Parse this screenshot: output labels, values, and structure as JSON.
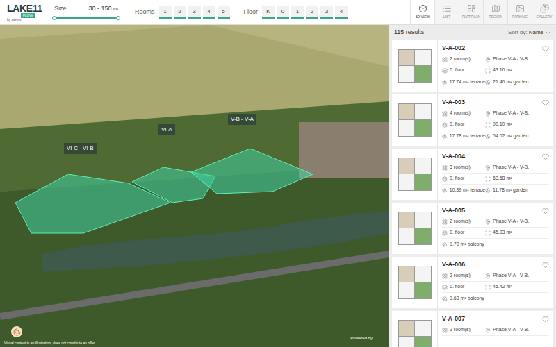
{
  "logo": {
    "name": "LAKE11",
    "badge": "FLOW",
    "by": "by atenor"
  },
  "filters": {
    "size": {
      "label": "Size",
      "value": "30 - 150",
      "unit": "m²",
      "level_start": 0,
      "level_end": 1
    },
    "rooms": {
      "label": "Rooms",
      "options": [
        {
          "label": "1",
          "selected": false
        },
        {
          "label": "2",
          "selected": false
        },
        {
          "label": "3",
          "selected": false
        },
        {
          "label": "4",
          "selected": false
        },
        {
          "label": "5",
          "selected": false
        }
      ]
    },
    "floor": {
      "label": "Floor",
      "options": [
        {
          "label": "K",
          "selected": false
        },
        {
          "label": "0",
          "selected": false
        },
        {
          "label": "1",
          "selected": false
        },
        {
          "label": "2",
          "selected": false
        },
        {
          "label": "3",
          "selected": false
        },
        {
          "label": "4",
          "selected": false
        }
      ]
    }
  },
  "views": [
    {
      "label": "3D VIEW",
      "selected": true
    },
    {
      "label": "LIST",
      "selected": false
    },
    {
      "label": "FLAT PLAN",
      "selected": false
    },
    {
      "label": "REGION",
      "selected": false
    },
    {
      "label": "PARKING",
      "selected": false
    },
    {
      "label": "GALLERY",
      "selected": false
    }
  ],
  "map": {
    "zones": [
      {
        "label": "VI-C - VI-B"
      },
      {
        "label": "VI-A"
      },
      {
        "label": "V-B - V-A"
      }
    ],
    "disclaimer": "Visual content is an illustration, does not constitute an offer.",
    "powered_by": "Powered by"
  },
  "results": {
    "count": "115 results",
    "sort_label": "Sort by:",
    "sort_value": "Name"
  },
  "flats": [
    {
      "code": "V-A-002",
      "rooms": "2 room(s)",
      "phase": "Phase V-A - V-B.",
      "floor": "0. floor",
      "area": "43.16 m²",
      "extras": [
        "17.74 m² terrace",
        "21.46 m² garden"
      ],
      "favorite": false
    },
    {
      "code": "V-A-003",
      "rooms": "4 room(s)",
      "phase": "Phase V-A - V-B.",
      "floor": "0. floor",
      "area": "90.10 m²",
      "extras": [
        "17.78 m² terrace",
        "54.62 m² garden"
      ],
      "favorite": false
    },
    {
      "code": "V-A-004",
      "rooms": "3 room(s)",
      "phase": "Phase V-A - V-B.",
      "floor": "0. floor",
      "area": "63.58 m²",
      "extras": [
        "10.39 m² terrace",
        "11.78 m² garden"
      ],
      "favorite": false
    },
    {
      "code": "V-A-005",
      "rooms": "2 room(s)",
      "phase": "Phase V-A - V-B.",
      "floor": "0. floor",
      "area": "45.03 m²",
      "extras": [
        "9.70 m² balcony"
      ],
      "favorite": false
    },
    {
      "code": "V-A-006",
      "rooms": "2 room(s)",
      "phase": "Phase V-A - V-B.",
      "floor": "0. floor",
      "area": "45.42 m²",
      "extras": [
        "9.63 m² balcony"
      ],
      "favorite": false
    },
    {
      "code": "V-A-007",
      "rooms": "2 room(s)",
      "phase": "Phase V-A - V-B.",
      "extras": [],
      "favorite": false
    }
  ]
}
